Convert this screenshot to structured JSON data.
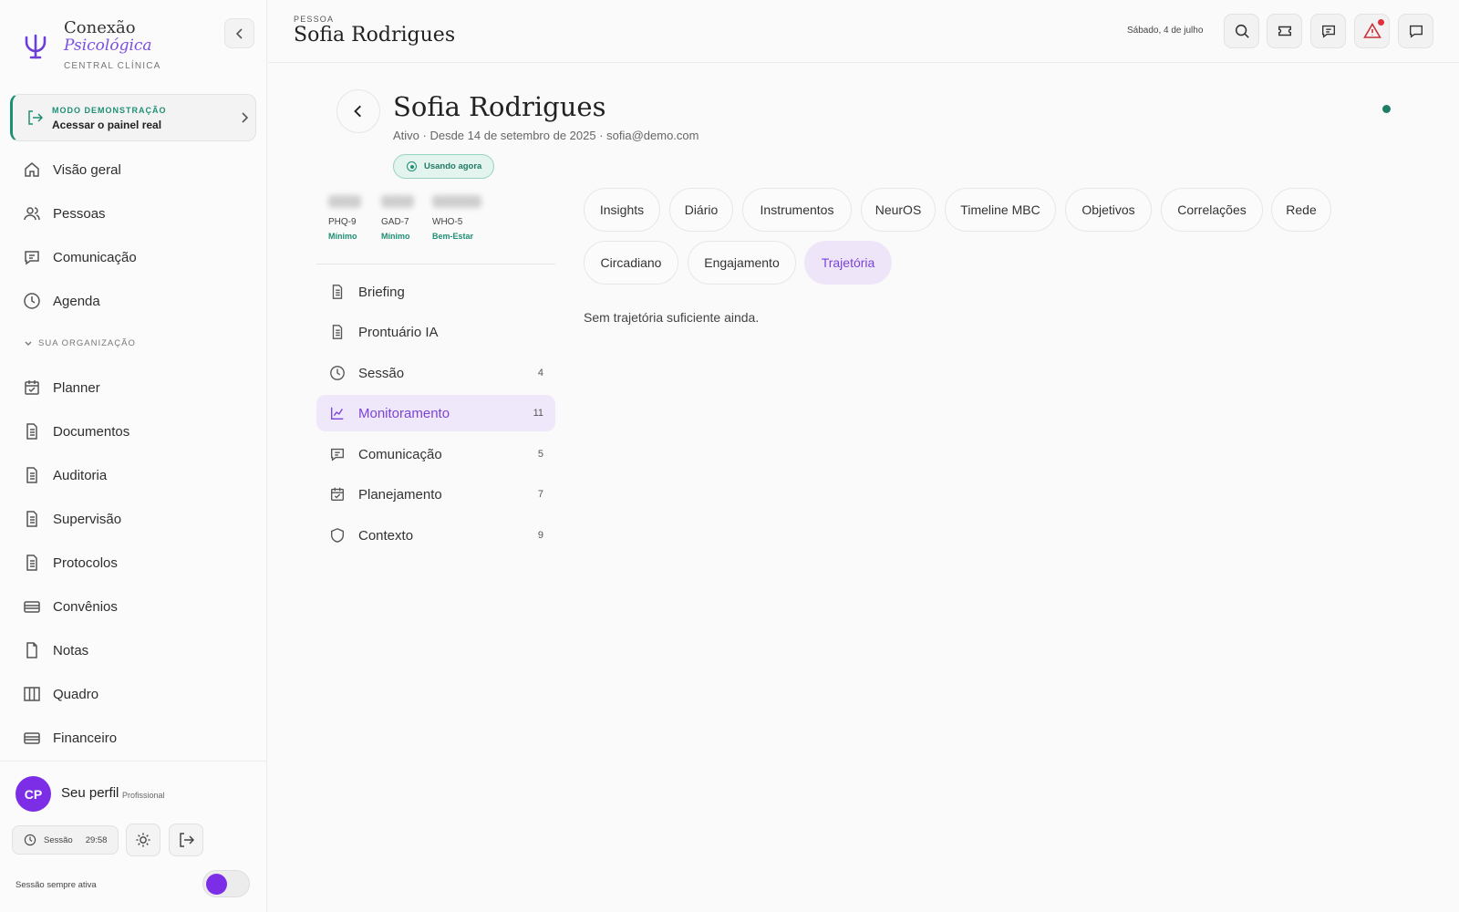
{
  "brand": {
    "line1": "Conexão",
    "line2": "Psicológica",
    "line3": "CENTRAL CLÍNICA"
  },
  "demo": {
    "kicker": "MODO DEMONSTRAÇÃO",
    "title": "Acessar o painel real"
  },
  "nav_primary": [
    {
      "label": "Visão geral",
      "icon": "home-icon"
    },
    {
      "label": "Pessoas",
      "icon": "users-icon"
    },
    {
      "label": "Comunicação",
      "icon": "chat-icon"
    },
    {
      "label": "Agenda",
      "icon": "clock-icon"
    }
  ],
  "section_label": "SUA ORGANIZAÇÃO",
  "nav_org": [
    {
      "label": "Planner",
      "icon": "calendar-check-icon"
    },
    {
      "label": "Documentos",
      "icon": "document-icon"
    },
    {
      "label": "Auditoria",
      "icon": "document-icon"
    },
    {
      "label": "Supervisão",
      "icon": "document-icon"
    },
    {
      "label": "Protocolos",
      "icon": "document-icon"
    },
    {
      "label": "Convênios",
      "icon": "card-icon"
    },
    {
      "label": "Notas",
      "icon": "file-icon"
    },
    {
      "label": "Quadro",
      "icon": "columns-icon"
    },
    {
      "label": "Financeiro",
      "icon": "card-icon"
    }
  ],
  "profile": {
    "initials": "CP",
    "name": "Seu perfil",
    "role": "Profissional"
  },
  "session": {
    "label": "Sessão",
    "time": "29:58",
    "always_label": "Sessão sempre ativa"
  },
  "header": {
    "crumb": "PESSOA",
    "title": "Sofia Rodrigues",
    "date": "Sábado, 4 de julho"
  },
  "person": {
    "name": "Sofia Rodrigues",
    "meta": "Ativo · Desde 14 de setembro de 2025 · sofia@demo.com",
    "badge": "Usando agora"
  },
  "scores": [
    {
      "name": "PHQ-9",
      "level": "Mínimo"
    },
    {
      "name": "GAD-7",
      "level": "Mínimo"
    },
    {
      "name": "WHO-5",
      "level": "Bem-Estar"
    }
  ],
  "side_menu": [
    {
      "label": "Briefing",
      "count": "",
      "icon": "document-icon"
    },
    {
      "label": "Prontuário IA",
      "count": "",
      "icon": "document-icon"
    },
    {
      "label": "Sessão",
      "count": "4",
      "icon": "clock-icon"
    },
    {
      "label": "Monitoramento",
      "count": "11",
      "icon": "chart-icon"
    },
    {
      "label": "Comunicação",
      "count": "5",
      "icon": "chat-icon"
    },
    {
      "label": "Planejamento",
      "count": "7",
      "icon": "calendar-check-icon"
    },
    {
      "label": "Contexto",
      "count": "9",
      "icon": "shield-icon"
    }
  ],
  "active_side": "Monitoramento",
  "tabs": [
    "Insights",
    "Diário",
    "Instrumentos",
    "NeurOS",
    "Timeline MBC",
    "Objetivos",
    "Correlações",
    "Rede",
    "Circadiano",
    "Engajamento",
    "Trajetória"
  ],
  "active_tab": "Trajetória",
  "empty_text": "Sem trajetória suficiente ainda.",
  "colors": {
    "accent": "#7a44d8",
    "teal": "#1f8f73",
    "alert": "#e0303c"
  }
}
